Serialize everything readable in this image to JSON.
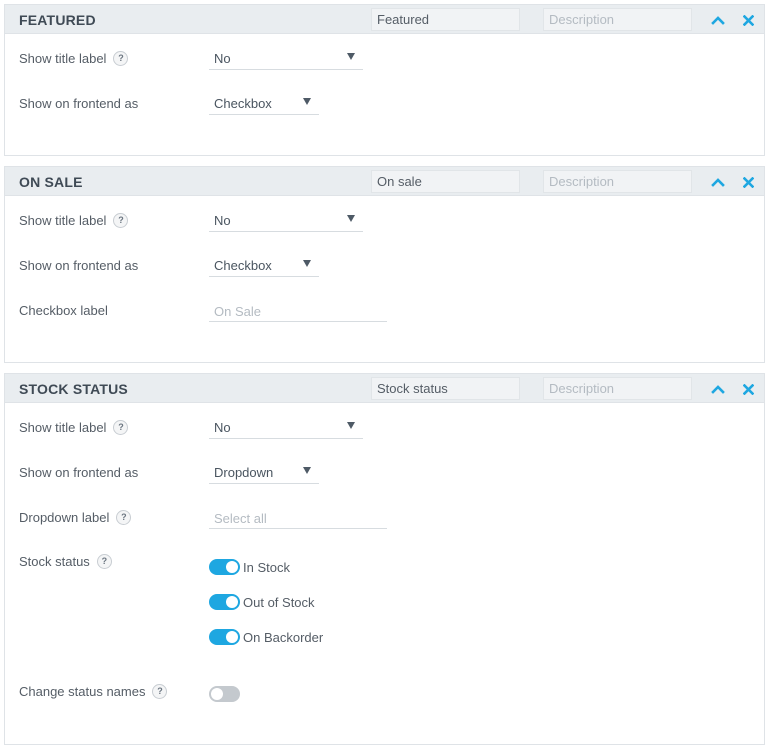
{
  "placeholders": {
    "description": "Description"
  },
  "labels": {
    "show_title_label": "Show title label",
    "show_on_frontend_as": "Show on frontend as",
    "checkbox_label": "Checkbox label",
    "dropdown_label": "Dropdown label",
    "stock_status": "Stock status",
    "change_status_names": "Change status names",
    "help_glyph": "?"
  },
  "colors": {
    "accent": "#1ea7e1",
    "header_bg": "#e9edf0",
    "toggle_off": "#c4c9ce"
  },
  "icons": {
    "collapse": "chevron-up-icon",
    "remove": "close-icon",
    "help": "question-icon"
  },
  "panels": {
    "featured": {
      "title": "FEATURED",
      "name_value": "Featured",
      "show_title_label": "No",
      "show_on_frontend_as": "Checkbox"
    },
    "on_sale": {
      "title": "ON SALE",
      "name_value": "On sale",
      "show_title_label": "No",
      "show_on_frontend_as": "Checkbox",
      "checkbox_label_placeholder": "On Sale"
    },
    "stock_status": {
      "title": "STOCK STATUS",
      "name_value": "Stock status",
      "show_title_label": "No",
      "show_on_frontend_as": "Dropdown",
      "dropdown_label_placeholder": "Select all",
      "statuses": [
        {
          "label": "In Stock",
          "enabled": true
        },
        {
          "label": "Out of Stock",
          "enabled": true
        },
        {
          "label": "On Backorder",
          "enabled": true
        }
      ],
      "change_status_names_enabled": false
    }
  }
}
